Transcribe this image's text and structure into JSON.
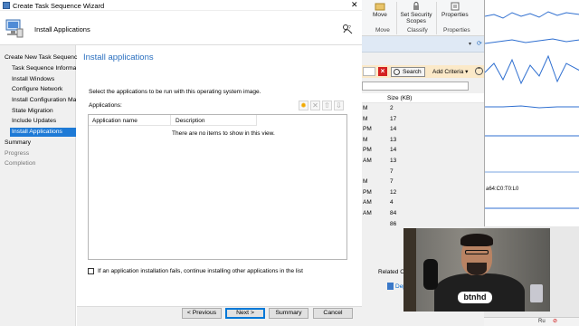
{
  "wizard": {
    "title": "Create Task Sequence Wizard",
    "header": "Install Applications",
    "page_title": "Install applications",
    "instruction": "Select the applications to be run with this operating system image.",
    "applications_label": "Applications:",
    "columns": [
      "Application name",
      "Description"
    ],
    "empty_text": "There are no items to show in this view.",
    "checkbox_label": "If an application installation fails, continue installing other applications in the list",
    "checkbox_checked": false,
    "nav": [
      {
        "label": "Create New Task Sequence",
        "level": "top",
        "state": "normal"
      },
      {
        "label": "Task Sequence Informati",
        "level": "sub",
        "state": "normal"
      },
      {
        "label": "Install Windows",
        "level": "sub",
        "state": "normal"
      },
      {
        "label": "Configure Network",
        "level": "sub",
        "state": "normal"
      },
      {
        "label": "Install Configuration Mar",
        "level": "sub",
        "state": "normal"
      },
      {
        "label": "State Migration",
        "level": "sub",
        "state": "normal"
      },
      {
        "label": "Include Updates",
        "level": "sub",
        "state": "normal"
      },
      {
        "label": "Install Applications",
        "level": "sub",
        "state": "selected"
      },
      {
        "label": "Summary",
        "level": "top",
        "state": "normal"
      },
      {
        "label": "Progress",
        "level": "top",
        "state": "dim"
      },
      {
        "label": "Completion",
        "level": "top",
        "state": "dim"
      }
    ],
    "buttons": {
      "previous": "< Previous",
      "next": "Next >",
      "summary": "Summary",
      "cancel": "Cancel"
    },
    "colors": {
      "accent": "#1e7ad6",
      "title_blue": "#2a6fbf"
    }
  },
  "console": {
    "ribbon": {
      "move": "Move",
      "set_security_scopes": "Set Security Scopes",
      "properties": "Properties",
      "group_move": "Move",
      "group_classify": "Classify",
      "group_properties": "Properties"
    },
    "search_button": "Search",
    "add_criteria": "Add Criteria",
    "size_header": "Size (KB)",
    "rows": [
      {
        "t": "M",
        "s": "2"
      },
      {
        "t": "M",
        "s": "17"
      },
      {
        "t": "PM",
        "s": "14"
      },
      {
        "t": "M",
        "s": "13"
      },
      {
        "t": "PM",
        "s": "14"
      },
      {
        "t": "AM",
        "s": "13"
      },
      {
        "t": "",
        "s": "7"
      },
      {
        "t": "M",
        "s": "7"
      },
      {
        "t": "PM",
        "s": "12"
      },
      {
        "t": "AM",
        "s": "4"
      },
      {
        "t": "AM",
        "s": "84"
      },
      {
        "t": "",
        "s": "86"
      }
    ],
    "related": "Related O",
    "dep_link": "Dep",
    "monitor_label": "a64:C0:T0:L0",
    "bottom_text": "Ru"
  },
  "webcam": {
    "logo": "btnhd"
  }
}
